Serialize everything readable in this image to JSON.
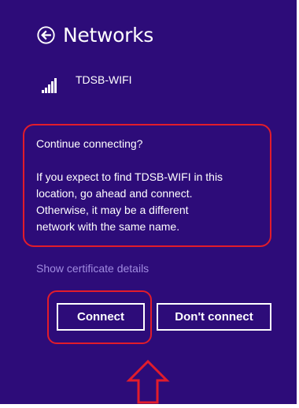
{
  "header": {
    "title": "Networks",
    "back_icon": "back-arrow-circle-icon"
  },
  "network": {
    "name": "TDSB-WIFI",
    "signal_icon": "wifi-signal-bars-icon"
  },
  "dialog": {
    "question": "Continue connecting?",
    "body_lines": [
      "If you expect to find TDSB-WIFI in this",
      "location, go ahead and connect.",
      "Otherwise, it may be a different",
      "network with the same name."
    ]
  },
  "links": {
    "certificate": "Show certificate details"
  },
  "buttons": {
    "connect": "Connect",
    "dont_connect": "Don't connect"
  },
  "annotations": {
    "highlight_color": "#e21c2b",
    "pointer": "up-arrow-icon"
  },
  "colors": {
    "background": "#2d0c79",
    "text": "#ffffff",
    "link": "#a08be0"
  }
}
